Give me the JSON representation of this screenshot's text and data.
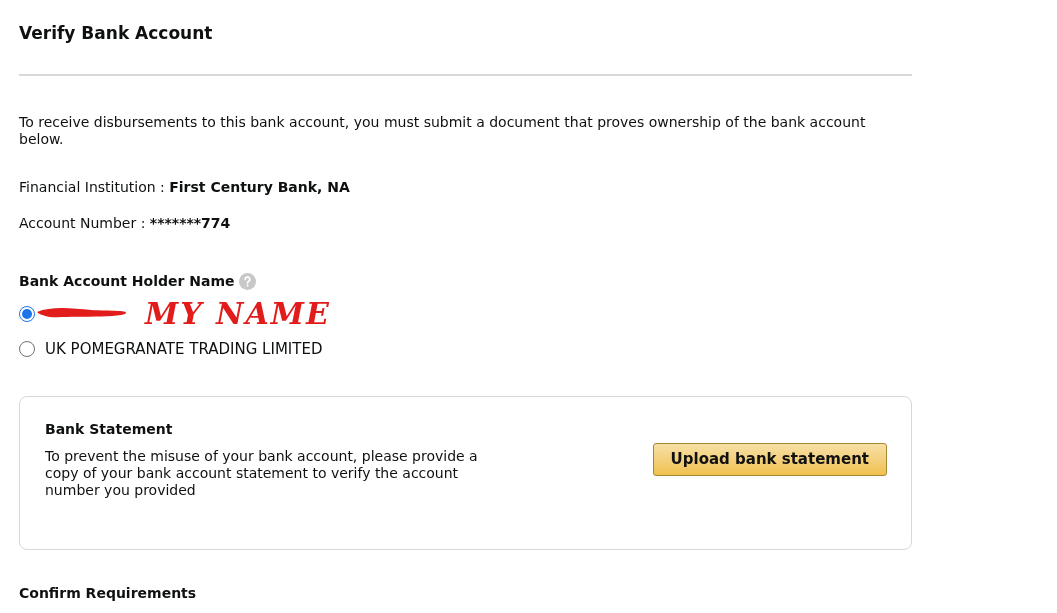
{
  "title": "Verify Bank Account",
  "intro": "To receive disbursements to this bank account, you must submit a document that proves ownership of the bank account below.",
  "details": [
    {
      "label": "Financial Institution : ",
      "value": "First Century Bank, NA"
    },
    {
      "label": "Account Number : ",
      "value": "*******774"
    }
  ],
  "holder": {
    "heading": "Bank Account Holder Name",
    "options": [
      {
        "kind": "redacted",
        "selected": true,
        "annotation": "MY NAME"
      },
      {
        "kind": "text",
        "label": "UK POMEGRANATE TRADING LIMITED",
        "selected": false
      }
    ]
  },
  "statement_card": {
    "title": "Bank Statement",
    "description": "To prevent the misuse of your bank account, please provide a copy of your bank account statement to verify the account number you provided",
    "button": "Upload bank statement"
  },
  "next_section": {
    "title": "Confirm Requirements"
  }
}
